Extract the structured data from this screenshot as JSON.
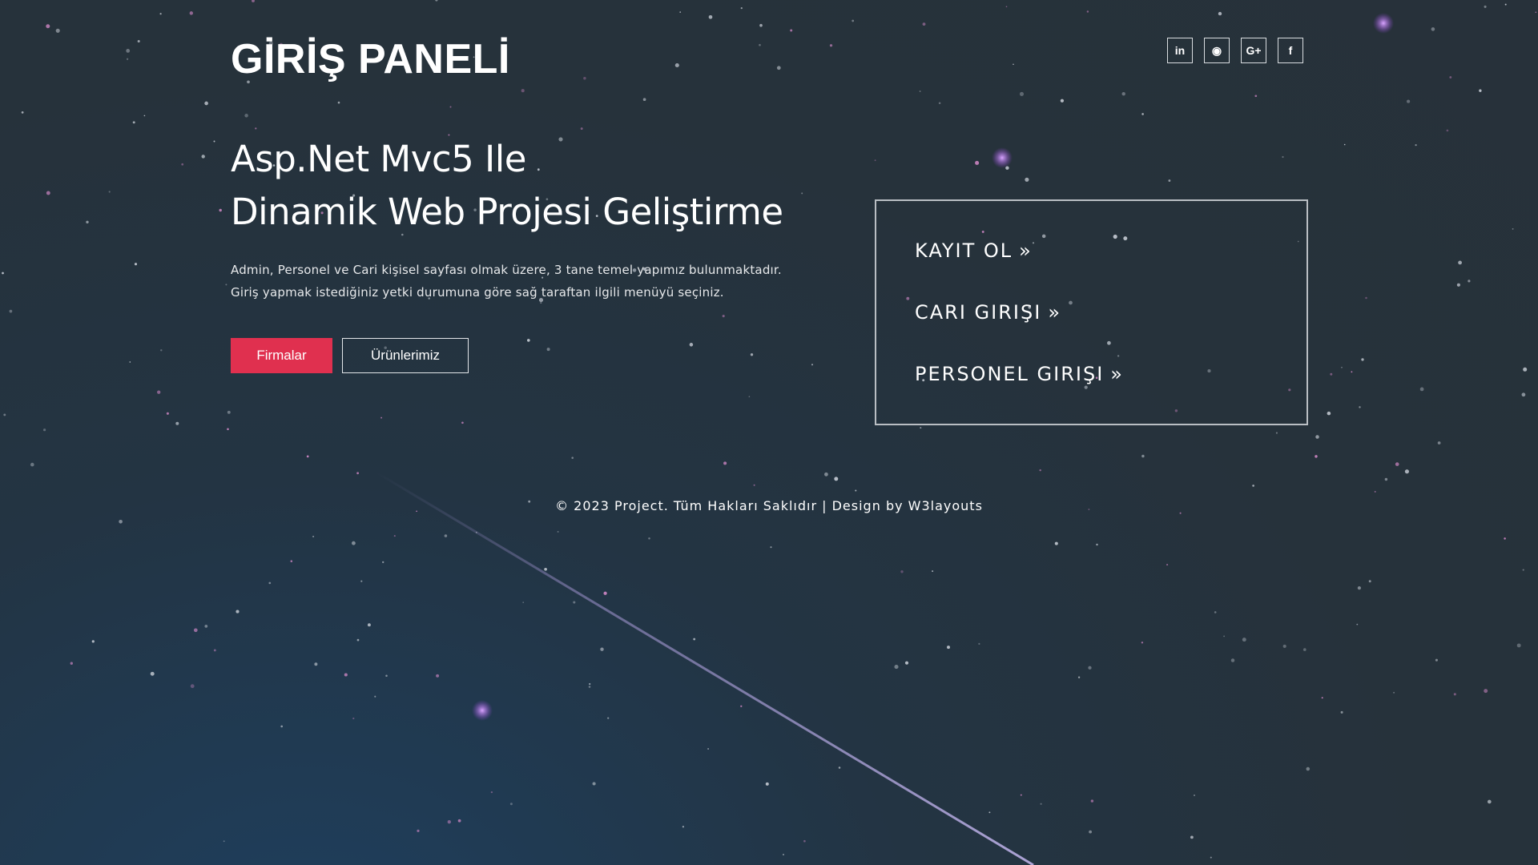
{
  "brand": "GİRİŞ PANELİ",
  "social": {
    "linkedin": "in",
    "github": "◉",
    "googleplus": "G+",
    "facebook": "f"
  },
  "hero": {
    "title_line1": "Asp.Net Mvc5 Ile",
    "title_line2": "Dinamik Web Projesi Geliştirme",
    "desc_line1": "Admin, Personel ve Cari kişisel sayfası olmak üzere, 3 tane temel yapımız bulunmaktadır.",
    "desc_line2": "Giriş yapmak istediğiniz yetki durumuna göre sağ taraftan ilgili menüyü seçiniz.",
    "btn_primary": "Firmalar",
    "btn_secondary": "Ürünlerimiz"
  },
  "menu": {
    "items": [
      {
        "label": "KAYIT OL",
        "arrow": "»"
      },
      {
        "label": "CARI GIRIŞI",
        "arrow": "»"
      },
      {
        "label": "PERSONEL GIRIŞI",
        "arrow": "»"
      }
    ]
  },
  "footer": "© 2023 Project. Tüm Hakları Saklıdır | Design by W3layouts",
  "colors": {
    "accent": "#e0304f",
    "background": "#26323b",
    "border": "#b9bec3"
  }
}
